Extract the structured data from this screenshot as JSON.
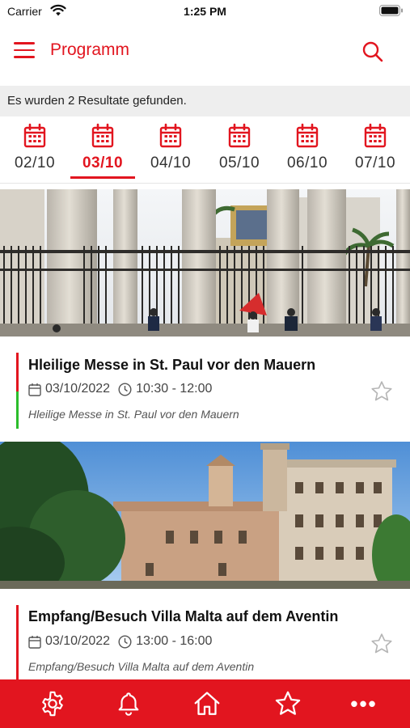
{
  "status_bar": {
    "carrier": "Carrier",
    "time": "1:25 PM"
  },
  "header": {
    "title": "Programm",
    "menu_icon": "hamburger-icon",
    "search_icon": "search-icon"
  },
  "results_text": "Es wurden 2 Resultate gefunden.",
  "date_tabs": [
    {
      "label": "02/10",
      "active": false
    },
    {
      "label": "03/10",
      "active": true
    },
    {
      "label": "04/10",
      "active": false
    },
    {
      "label": "05/10",
      "active": false
    },
    {
      "label": "06/10",
      "active": false
    },
    {
      "label": "07/10",
      "active": false
    }
  ],
  "events": [
    {
      "title": "Hleilige Messe in St. Paul vor den Mauern",
      "date": "03/10/2022",
      "time": "10:30 - 12:00",
      "description": "Hleilige Messe in St. Paul vor den Mauern",
      "favorite": false
    },
    {
      "title": "Empfang/Besuch Villa Malta auf dem Aventin",
      "date": "03/10/2022",
      "time": "13:00 - 16:00",
      "description": "Empfang/Besuch Villa Malta auf dem Aventin",
      "favorite": false
    }
  ],
  "bottom_nav": [
    {
      "icon": "gear-icon"
    },
    {
      "icon": "bell-icon"
    },
    {
      "icon": "home-icon"
    },
    {
      "icon": "star-icon"
    },
    {
      "icon": "more-icon",
      "label": "•••"
    }
  ],
  "colors": {
    "accent": "#e2151f",
    "green_marker": "#2bbd2b",
    "results_bg": "#eeeeee"
  }
}
